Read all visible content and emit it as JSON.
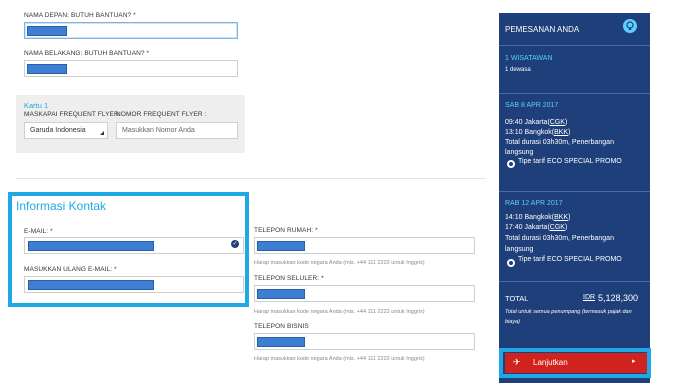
{
  "personal": {
    "first_name_label": "NAMA DEPAN: BUTUH BANTUAN? *",
    "last_name_label": "NAMA BELAKANG: BUTUH BANTUAN? *"
  },
  "frequent_flyer": {
    "section_title": "Kartu 1",
    "airline_label": "MASKAPAI FREQUENT FLYER:",
    "number_label": "NOMOR FREQUENT FLYER :",
    "airline_value": "Garuda Indonesia",
    "number_placeholder": "Masukkan Nomor Anda"
  },
  "contact": {
    "title": "Informasi Kontak",
    "email_label": "E-MAIL: *",
    "email_confirm_label": "MASUKKAN ULANG E-MAIL: *",
    "home_phone_label": "TELEPON RUMAH: *",
    "mobile_phone_label": "TELEPON SELULER: *",
    "business_phone_label": "TELEPON BISNIS",
    "phone_hint": "Harap masukkan kode negara Anda (mis. +44 111 2222 untuk Inggris)"
  },
  "booking": {
    "title": "PEMESANAN ANDA",
    "travelers": "1 WISATAWAN",
    "travelers_detail": "1 dewasa",
    "outbound": {
      "date": "SAB 8 APR 2017",
      "depart_time": "09:40",
      "depart_city": "Jakarta",
      "depart_code": "CGK",
      "arrive_time": "13:10",
      "arrive_city": "Bangkok",
      "arrive_code": "BKK",
      "duration_line1": "Total durasi 03h30m, Penerbangan",
      "duration_line2": "langsung",
      "fare_prefix": "Tipe tarif",
      "fare_name": "ECO SPECIAL PROMO"
    },
    "return": {
      "date": "RAB 12 APR 2017",
      "depart_time": "14:10",
      "depart_city": "Bangkok",
      "depart_code": "BKK",
      "arrive_time": "17:40",
      "arrive_city": "Jakarta",
      "arrive_code": "CGK",
      "duration_line1": "Total durasi 03h30m, Penerbangan",
      "duration_line2": "langsung",
      "fare_prefix": "Tipe tarif",
      "fare_name": "ECO SPECIAL PROMO"
    },
    "total_label": "TOTAL",
    "currency": "IDR",
    "total_amount": "5,128,300",
    "total_note_line1": "Total untuk semua penumpang (termasuk pajak dan",
    "total_note_line2": "biaya)",
    "continue_label": "Lanjutkan"
  },
  "colors": {
    "sidebar_bg": "#1e3f7a",
    "accent_cyan": "#5bd0ff",
    "highlight": "#1fa8e6",
    "button_red": "#d1221e",
    "redaction": "#3f7fd3"
  }
}
